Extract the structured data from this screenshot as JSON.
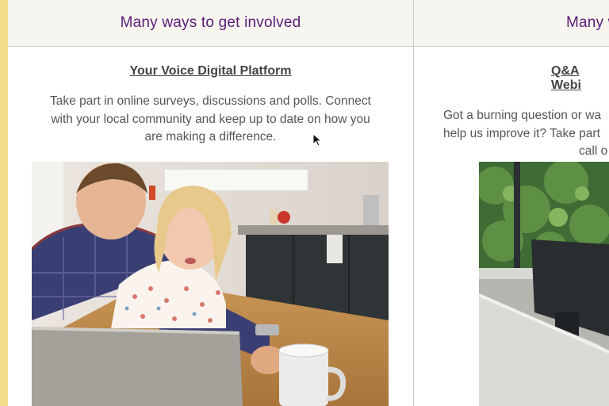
{
  "section_heading": "Many ways to get involved",
  "section_heading_cut": "Many w",
  "cards": [
    {
      "title": "Your Voice Digital Platform",
      "description_lines": [
        "Take part in online surveys, discussions and polls. Connect",
        "with your local community and keep up to date on how you",
        "are making a difference."
      ],
      "image_alt": "Father and young daughter using a laptop in a kitchen"
    },
    {
      "title": "Q&A Webi",
      "description_lines": [
        "Got a burning question or wa",
        "help us improve it? Take part",
        "call o"
      ],
      "image_alt": "Office desk with computer monitor by a window"
    }
  ],
  "colors": {
    "heading": "#5a1b78",
    "accent_strip": "#f3df8a",
    "header_bg": "#f7f5ef"
  }
}
